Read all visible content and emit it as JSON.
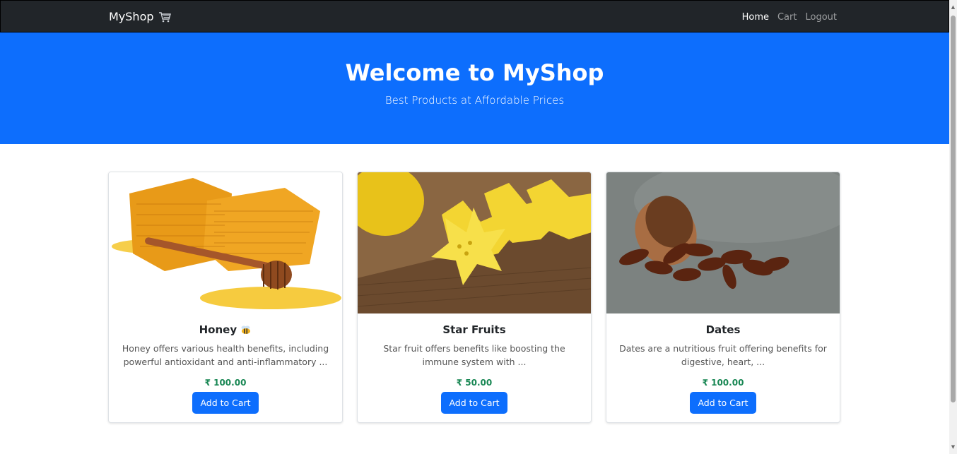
{
  "navbar": {
    "brand": "MyShop",
    "brand_icon": "shopping-cart-icon",
    "links": [
      {
        "label": "Home",
        "active": true
      },
      {
        "label": "Cart",
        "active": false
      },
      {
        "label": "Logout",
        "active": false
      }
    ]
  },
  "hero": {
    "title": "Welcome to MyShop",
    "subtitle": "Best Products at Affordable Prices",
    "color": "#0d6efd"
  },
  "products": [
    {
      "name": "Honey",
      "name_icon": "bee-icon",
      "image": "honeycomb-image",
      "description": "Honey offers various health benefits, including powerful antioxidant and anti-inflammatory ...",
      "price": "₹ 100.00",
      "button": "Add to Cart"
    },
    {
      "name": "Star Fruits",
      "image": "star-fruit-image",
      "description": "Star fruit offers benefits like boosting the immune system with ...",
      "price": "₹ 50.00",
      "button": "Add to Cart"
    },
    {
      "name": "Dates",
      "image": "dates-image",
      "description": "Dates are a nutritious fruit offering benefits for digestive, heart, ...",
      "price": "₹ 100.00",
      "button": "Add to Cart"
    }
  ],
  "colors": {
    "navbar": "#212529",
    "primary": "#0d6efd",
    "price": "#198754"
  }
}
